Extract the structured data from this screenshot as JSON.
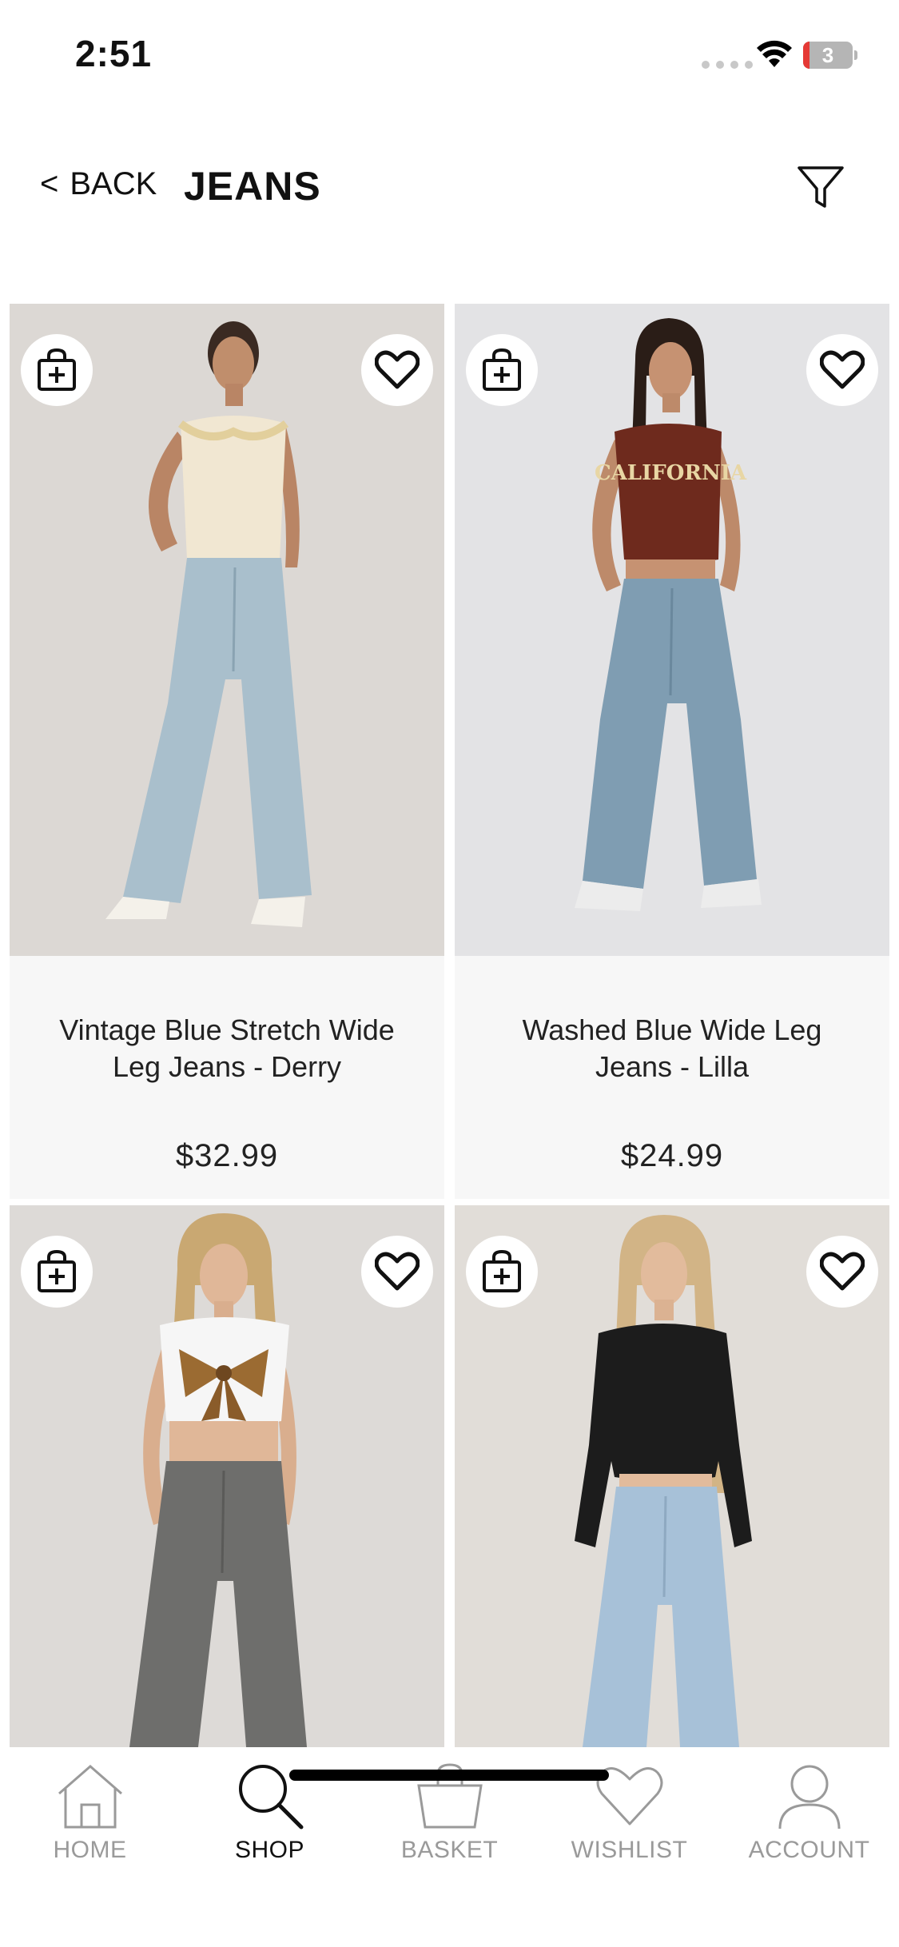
{
  "status_bar": {
    "time": "2:51",
    "battery_level": "3",
    "battery_color": "#e53935"
  },
  "header": {
    "back_chevron": "<",
    "back_label": "BACK",
    "title": "JEANS",
    "filter_icon": "filter-icon"
  },
  "products": [
    {
      "name": "Vintage Blue Stretch Wide Leg Jeans - Derry",
      "price": "$32.99",
      "top_color": "#f1e7d2",
      "jeans_color": "#a9bfcc",
      "hair_color": "#3a2a22",
      "bg_color": "#dcd8d4"
    },
    {
      "name": "Washed Blue Wide Leg Jeans - Lilla",
      "price": "$24.99",
      "top_color": "#6e2a1d",
      "top_text": "CALIFORNIA",
      "jeans_color": "#7f9db2",
      "hair_color": "#2a1d17",
      "bg_color": "#e3e3e5"
    },
    {
      "top_color": "#f6f6f6",
      "jeans_color": "#6e6e6c",
      "hair_color": "#c9a872",
      "bg_color": "#dddad7"
    },
    {
      "top_color": "#1c1c1c",
      "jeans_color": "#a7c1d8",
      "hair_color": "#d2b486",
      "bg_color": "#e1ddd8"
    }
  ],
  "tab_bar": {
    "items": [
      {
        "label": "HOME",
        "icon": "home-icon",
        "active": false
      },
      {
        "label": "SHOP",
        "icon": "search-icon",
        "active": true
      },
      {
        "label": "BASKET",
        "icon": "basket-icon",
        "active": false
      },
      {
        "label": "WISHLIST",
        "icon": "heart-icon",
        "active": false
      },
      {
        "label": "ACCOUNT",
        "icon": "account-icon",
        "active": false
      }
    ]
  }
}
